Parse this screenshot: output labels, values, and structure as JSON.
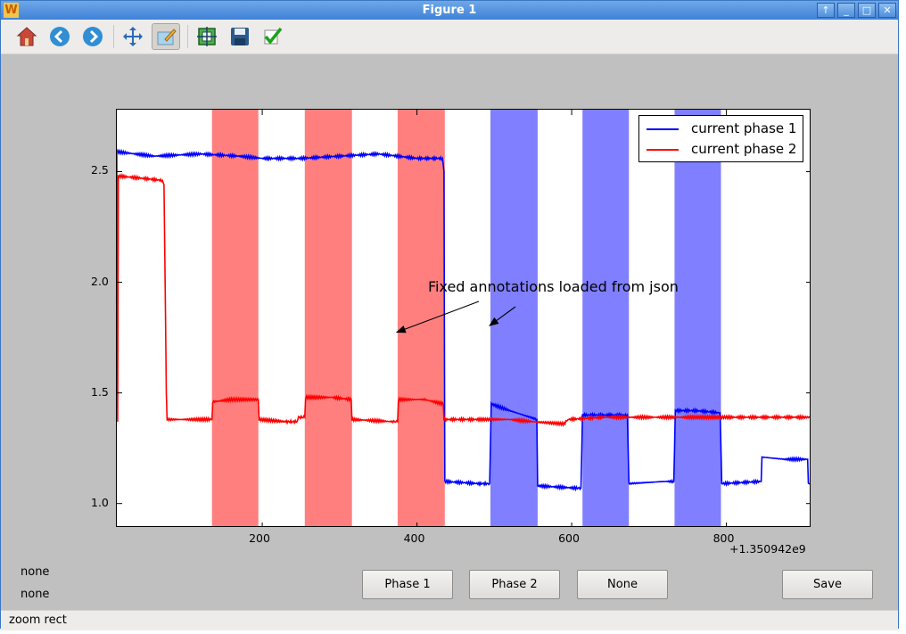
{
  "window": {
    "title": "Figure 1",
    "app_icon": "W",
    "controls": [
      "pin-icon",
      "minimize-icon",
      "maximize-icon",
      "close-icon"
    ],
    "control_glyphs": [
      "↑",
      "_",
      "□",
      "✕"
    ]
  },
  "toolbar": {
    "tools": [
      "home-icon",
      "back-icon",
      "forward-icon",
      "pan-icon",
      "zoom-rect-icon",
      "subplots-icon",
      "save-icon",
      "edit-check-icon"
    ],
    "active_tool": "zoom-rect-icon"
  },
  "chart_data": {
    "type": "line",
    "xlim": [
      12,
      910
    ],
    "ylim": [
      0.89,
      2.78
    ],
    "x_ticks": [
      200,
      400,
      600,
      800
    ],
    "y_ticks": [
      1.0,
      1.5,
      2.0,
      2.5
    ],
    "x_tick_labels": [
      "200",
      "400",
      "600",
      "800"
    ],
    "y_tick_labels": [
      "1.0",
      "1.5",
      "2.0",
      "2.5"
    ],
    "x_offset_label": "+1.350942e9",
    "grid": false,
    "legend_position": "top-right",
    "series": [
      {
        "name": "current phase 1",
        "color": "#0000ff",
        "points": [
          [
            12,
            2.59
          ],
          [
            60,
            2.57
          ],
          [
            120,
            2.58
          ],
          [
            170,
            2.57
          ],
          [
            200,
            2.56
          ],
          [
            250,
            2.56
          ],
          [
            300,
            2.57
          ],
          [
            350,
            2.58
          ],
          [
            400,
            2.56
          ],
          [
            433,
            2.56
          ],
          [
            435,
            2.5
          ],
          [
            436,
            1.1
          ],
          [
            480,
            1.09
          ],
          [
            494,
            1.09
          ],
          [
            496,
            1.45
          ],
          [
            520,
            1.42
          ],
          [
            555,
            1.38
          ],
          [
            556,
            1.08
          ],
          [
            605,
            1.07
          ],
          [
            612,
            1.07
          ],
          [
            614,
            1.4
          ],
          [
            640,
            1.4
          ],
          [
            672,
            1.4
          ],
          [
            674,
            1.09
          ],
          [
            720,
            1.1
          ],
          [
            732,
            1.1
          ],
          [
            734,
            1.42
          ],
          [
            760,
            1.42
          ],
          [
            792,
            1.41
          ],
          [
            794,
            1.09
          ],
          [
            845,
            1.1
          ],
          [
            846,
            1.21
          ],
          [
            875,
            1.2
          ],
          [
            905,
            1.2
          ],
          [
            906,
            1.09
          ],
          [
            950,
            1.09
          ],
          [
            964,
            1.09
          ],
          [
            965,
            1.19
          ],
          [
            1000,
            1.2
          ]
        ]
      },
      {
        "name": "current phase 2",
        "color": "#ff0000",
        "points": [
          [
            12,
            2.6
          ],
          [
            13,
            1.37
          ],
          [
            14,
            2.48
          ],
          [
            45,
            2.47
          ],
          [
            71,
            2.46
          ],
          [
            73,
            2.44
          ],
          [
            76,
            1.5
          ],
          [
            77,
            1.38
          ],
          [
            130,
            1.38
          ],
          [
            135,
            1.38
          ],
          [
            136,
            1.46
          ],
          [
            160,
            1.47
          ],
          [
            195,
            1.47
          ],
          [
            196,
            1.38
          ],
          [
            230,
            1.37
          ],
          [
            245,
            1.37
          ],
          [
            247,
            1.39
          ],
          [
            255,
            1.39
          ],
          [
            256,
            1.48
          ],
          [
            290,
            1.48
          ],
          [
            315,
            1.47
          ],
          [
            316,
            1.38
          ],
          [
            370,
            1.37
          ],
          [
            375,
            1.37
          ],
          [
            376,
            1.47
          ],
          [
            410,
            1.47
          ],
          [
            434,
            1.45
          ],
          [
            435,
            1.38
          ],
          [
            480,
            1.38
          ],
          [
            520,
            1.38
          ],
          [
            550,
            1.37
          ],
          [
            590,
            1.36
          ],
          [
            595,
            1.38
          ],
          [
            640,
            1.39
          ],
          [
            700,
            1.39
          ],
          [
            760,
            1.39
          ],
          [
            800,
            1.39
          ],
          [
            850,
            1.39
          ],
          [
            900,
            1.39
          ],
          [
            1000,
            1.39
          ]
        ]
      }
    ],
    "spans": [
      {
        "x0": 135,
        "x1": 195,
        "color": "#ff0000"
      },
      {
        "x0": 255,
        "x1": 316,
        "color": "#ff0000"
      },
      {
        "x0": 375,
        "x1": 436,
        "color": "#ff0000"
      },
      {
        "x0": 495,
        "x1": 556,
        "color": "#0000ff"
      },
      {
        "x0": 614,
        "x1": 674,
        "color": "#0000ff"
      },
      {
        "x0": 733,
        "x1": 793,
        "color": "#0000ff"
      }
    ],
    "annotation": {
      "text": "Fixed annotations loaded from json",
      "arrow_targets": [
        [
          375,
          1.77
        ],
        [
          495,
          1.8
        ]
      ]
    }
  },
  "labels": {
    "status_line_1": "none",
    "status_line_2": "none"
  },
  "buttons": {
    "phase1": "Phase 1",
    "phase2": "Phase 2",
    "none": "None",
    "save": "Save"
  },
  "statusbar": {
    "mode": "zoom rect"
  }
}
